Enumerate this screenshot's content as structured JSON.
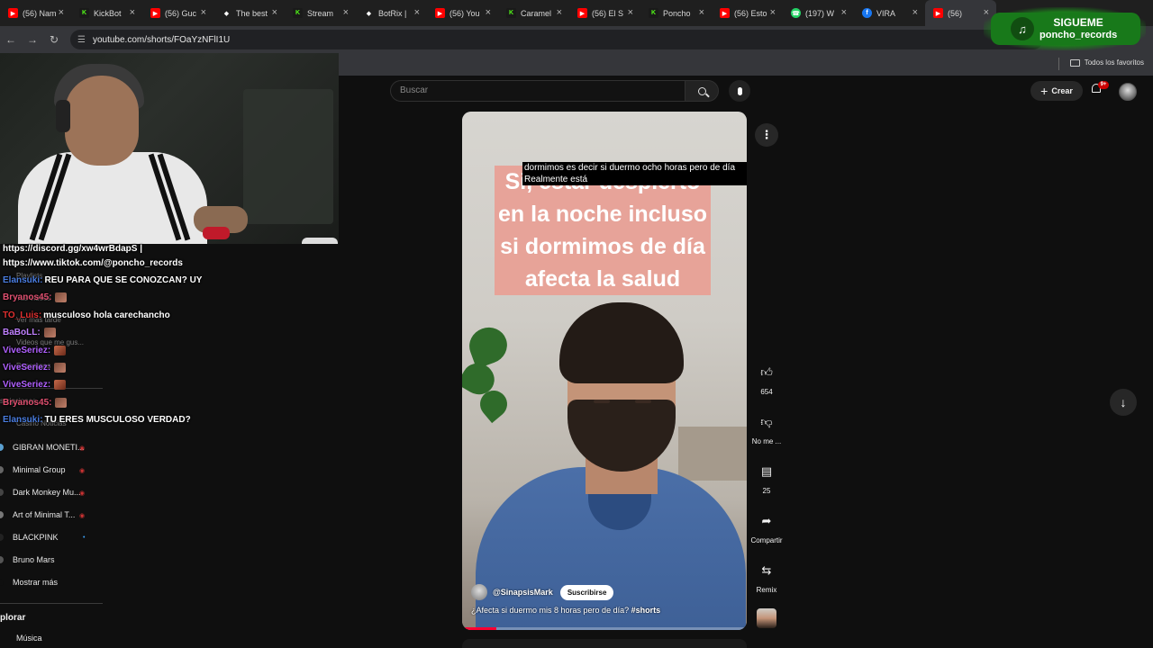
{
  "tabs": [
    {
      "title": "(56) Nam",
      "icon": "youtube-icon"
    },
    {
      "title": "KickBot",
      "icon": "kick-icon"
    },
    {
      "title": "(56) Guc",
      "icon": "youtube-icon"
    },
    {
      "title": "The best",
      "icon": "diamond-icon"
    },
    {
      "title": "Stream",
      "icon": "kick-icon"
    },
    {
      "title": "BotRix |",
      "icon": "diamond-icon"
    },
    {
      "title": "(56) You",
      "icon": "youtube-icon"
    },
    {
      "title": "Caramel",
      "icon": "kick-icon"
    },
    {
      "title": "(56) El S",
      "icon": "youtube-icon"
    },
    {
      "title": "Poncho",
      "icon": "kick-icon"
    },
    {
      "title": "(56) Esto",
      "icon": "youtube-icon"
    },
    {
      "title": "(197) W",
      "icon": "whatsapp-icon"
    },
    {
      "title": "VIRA",
      "icon": "facebook-icon"
    },
    {
      "title": "(56)",
      "icon": "youtube-icon"
    }
  ],
  "address_bar": {
    "url": "youtube.com/shorts/FOaYzNFlI1U"
  },
  "bookmarks": {
    "folder_label": "Todos los favoritos"
  },
  "youtube": {
    "search_placeholder": "Buscar",
    "create_label": "Crear",
    "notification_count": "9+"
  },
  "overlay": {
    "tiktok_line1": "SIGUEME",
    "tiktok_line2": "poncho_records"
  },
  "chat": [
    {
      "user": "",
      "text": "https://discord.gg/xw4wrBdapS |",
      "user_color": "#ffffff"
    },
    {
      "user": "",
      "text": "https://www.tiktok.com/@poncho_records",
      "user_color": "#ffffff"
    },
    {
      "user": "Elansuki:",
      "text": "REU PARA QUE SE CONOZCAN? UY",
      "user_color": "#4a7de0"
    },
    {
      "user": "Bryanos45:",
      "text": "",
      "user_color": "#e05070",
      "emote": true
    },
    {
      "user": "TO_Luis:",
      "text": "musculoso hola carechancho",
      "user_color": "#e03030"
    },
    {
      "user": "BaBoLL:",
      "text": "",
      "user_color": "#c080ff",
      "emote": true
    },
    {
      "user": "ViveSeriez:",
      "text": "",
      "user_color": "#b060ff",
      "emote": true
    },
    {
      "user": "ViveSeriez:",
      "text": "",
      "user_color": "#b060ff",
      "emote": true
    },
    {
      "user": "ViveSeriez:",
      "text": "",
      "user_color": "#b060ff",
      "emote": true
    },
    {
      "user": "Bryanos45:",
      "text": "",
      "user_color": "#e05070",
      "emote": true
    },
    {
      "user": "Elansuki:",
      "text": "TU ERES MUSCULOSO VERDAD?",
      "user_color": "#4a7de0"
    }
  ],
  "sidebar": {
    "faint_items": [
      "Playlists",
      "Tus videos",
      "Ver más tarde",
      "Videos que me gus...",
      "Descargas",
      "scripciones",
      "Casino Noticias"
    ],
    "subscriptions": [
      {
        "name": "GIBRAN MONETI...",
        "dot_color": "#5aa0d0",
        "live": true
      },
      {
        "name": "Minimal Group",
        "dot_color": "#666666",
        "live": true
      },
      {
        "name": "Dark Monkey Mu...",
        "dot_color": "#444444",
        "live": true
      },
      {
        "name": "Art of Minimal T...",
        "dot_color": "#777777",
        "live": true
      },
      {
        "name": "BLACKPINK",
        "dot_color": "#222222",
        "live": false,
        "new": true
      },
      {
        "name": "Bruno Mars",
        "dot_color": "#555555",
        "live": false
      },
      {
        "name": "Mostrar más",
        "dot_color": "#0f0f0f",
        "live": false
      }
    ],
    "explore_section": "plorar",
    "explore_items": [
      "Música"
    ]
  },
  "short": {
    "caption": "Si, estar despierto en la noche incluso si dormimos de día afecta la salud",
    "subtitle_cc": "dormimos es decir si duermo ocho horas pero de día Realmente está",
    "channel": "@SinapsisMark",
    "subscribe_label": "Suscribirse",
    "title": "¿Afecta si duermo mis 8 horas pero de día?",
    "hashtag": "#shorts",
    "progress": 0.12
  },
  "actions": {
    "like_count": "654",
    "dislike_label": "No me ...",
    "comments_count": "25",
    "share_label": "Compartir",
    "remix_label": "Remix"
  },
  "colors": {
    "accent_red": "#ff0033",
    "caption_bg": "#e8a096",
    "tiktok_green": "#18791a"
  }
}
